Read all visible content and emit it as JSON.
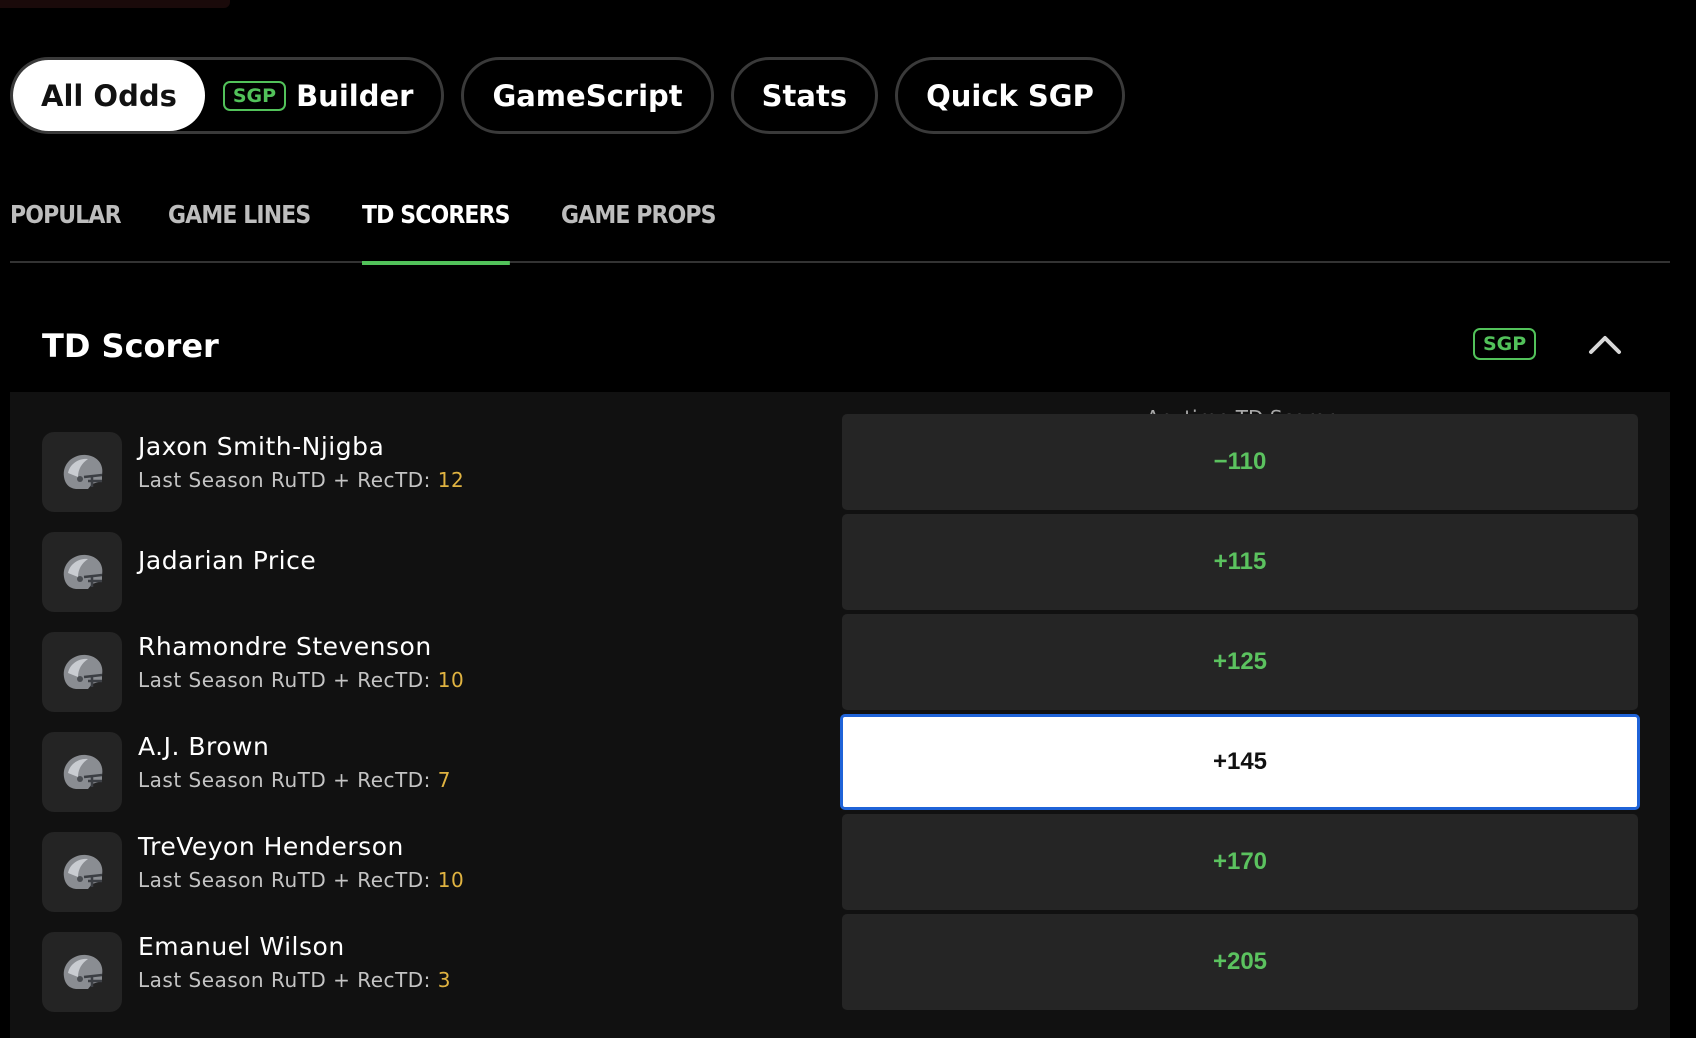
{
  "mode_tabs": {
    "all_odds": "All Odds",
    "sgp_tag": "SGP",
    "builder": "Builder",
    "gamescript": "GameScript",
    "stats": "Stats",
    "quick_sgp": "Quick SGP"
  },
  "category_tabs": [
    "POPULAR",
    "GAME LINES",
    "TD SCORERS",
    "GAME PROPS"
  ],
  "active_category": "TD SCORERS",
  "section": {
    "title": "TD Scorer",
    "sgp_badge": "SGP",
    "collapse_icon": "chevron-up-icon"
  },
  "market": {
    "column_header": "Anytime TD Scorer",
    "stat_label": "Last Season RuTD + RecTD:",
    "players": [
      {
        "name": "Jaxon Smith-Njigba",
        "stat": "12",
        "odds": "−110",
        "selected": false
      },
      {
        "name": "Jadarian Price",
        "stat": null,
        "odds": "+115",
        "selected": false
      },
      {
        "name": "Rhamondre Stevenson",
        "stat": "10",
        "odds": "+125",
        "selected": false
      },
      {
        "name": "A.J. Brown",
        "stat": "7",
        "odds": "+145",
        "selected": true
      },
      {
        "name": "TreVeyon Henderson",
        "stat": "10",
        "odds": "+170",
        "selected": false
      },
      {
        "name": "Emanuel Wilson",
        "stat": "3",
        "odds": "+205",
        "selected": false
      }
    ]
  },
  "colors": {
    "accent_green": "#52c25a",
    "stat_gold": "#e0b341",
    "selected_border": "#1f63d8"
  }
}
